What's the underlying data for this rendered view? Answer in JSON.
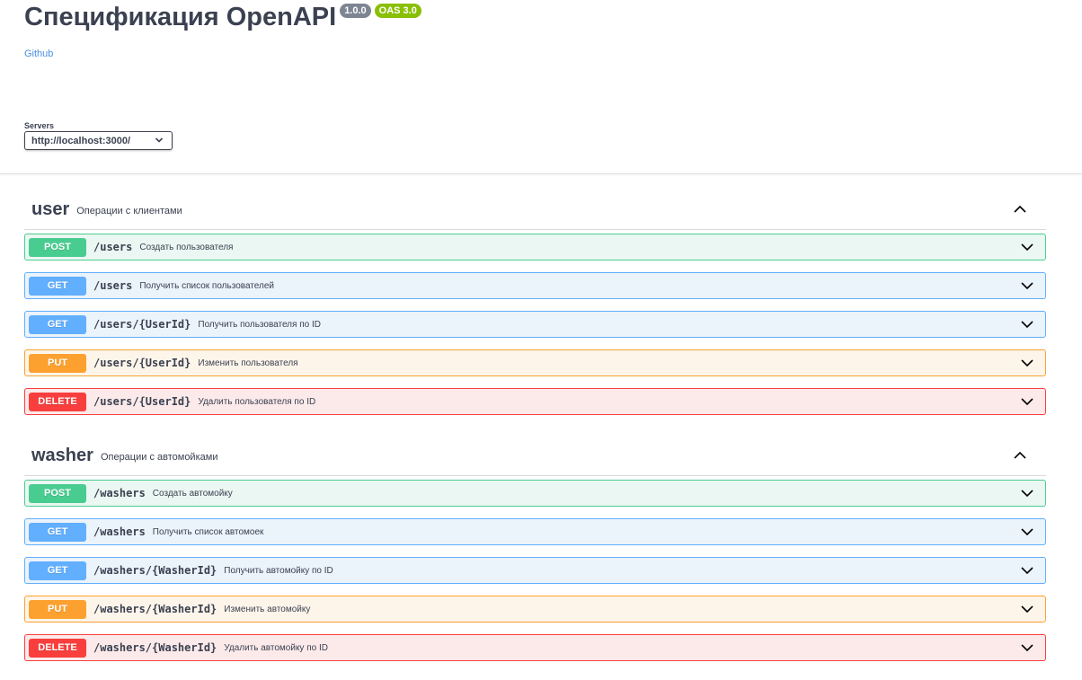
{
  "info": {
    "title": "Спецификация OpenAPI",
    "version": "1.0.0",
    "oas": "OAS 3.0",
    "link": "Github"
  },
  "servers": {
    "label": "Servers",
    "selected": "http://localhost:3000/"
  },
  "tags": [
    {
      "name": "user",
      "description": "Операции с клиентами",
      "operations": [
        {
          "method": "POST",
          "path": "/users",
          "summary": "Создать пользователя"
        },
        {
          "method": "GET",
          "path": "/users",
          "summary": "Получить список пользователей"
        },
        {
          "method": "GET",
          "path": "/users/{UserId}",
          "summary": "Получить пользователя по ID"
        },
        {
          "method": "PUT",
          "path": "/users/{UserId}",
          "summary": "Изменить пользователя"
        },
        {
          "method": "DELETE",
          "path": "/users/{UserId}",
          "summary": "Удалить пользователя по ID"
        }
      ]
    },
    {
      "name": "washer",
      "description": "Операции с автомойками",
      "operations": [
        {
          "method": "POST",
          "path": "/washers",
          "summary": "Создать автомойку"
        },
        {
          "method": "GET",
          "path": "/washers",
          "summary": "Получить список автомоек"
        },
        {
          "method": "GET",
          "path": "/washers/{WasherId}",
          "summary": "Получить автомойку по ID"
        },
        {
          "method": "PUT",
          "path": "/washers/{WasherId}",
          "summary": "Изменить автомойку"
        },
        {
          "method": "DELETE",
          "path": "/washers/{WasherId}",
          "summary": "Удалить автомойку по ID"
        }
      ]
    }
  ],
  "colors": {
    "post": "#49cc90",
    "get": "#61affe",
    "put": "#fca130",
    "delete": "#f93e3e",
    "link": "#4990e2"
  },
  "icons": {
    "tag_toggle": "chevron-up-icon",
    "operation_expand": "chevron-down-icon",
    "server_dropdown": "chevron-down-icon"
  }
}
